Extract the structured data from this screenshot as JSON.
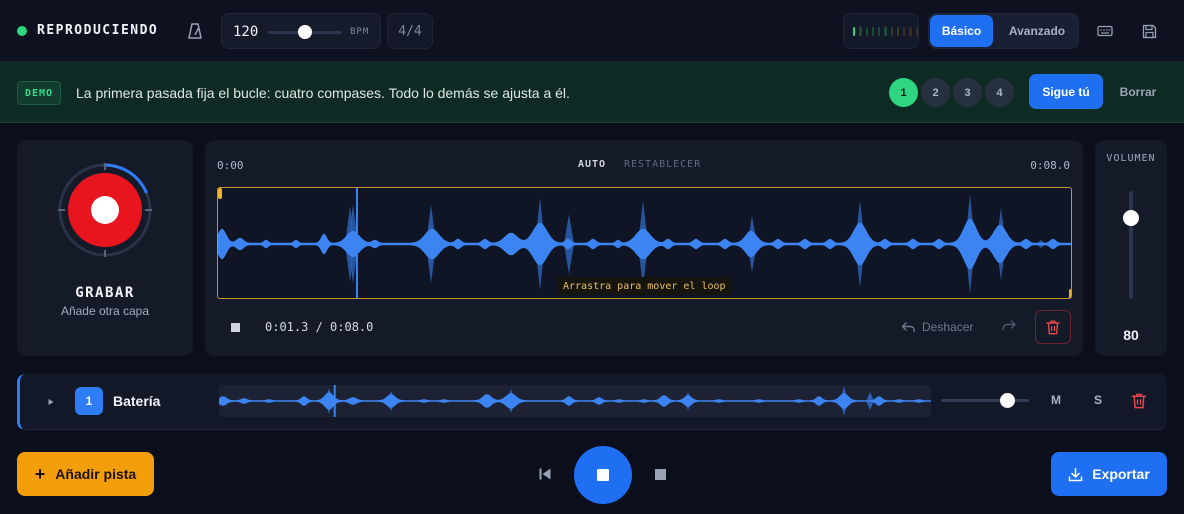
{
  "header": {
    "status": "REPRODUCIENDO",
    "bpm_value": "120",
    "bpm_unit": "BPM",
    "time_signature": "4/4",
    "mode_basic": "Básico",
    "mode_advanced": "Avanzado",
    "bpm_slider_fraction": 0.45
  },
  "banner": {
    "badge": "DEMO",
    "message": "La primera pasada fija el bucle: cuatro compases. Todo lo demás se ajusta a él.",
    "steps": [
      "1",
      "2",
      "3",
      "4"
    ],
    "active_step": "1",
    "follow_label": "Sigue tú",
    "clear_label": "Borrar"
  },
  "record": {
    "label": "GRABAR",
    "sublabel": "Añade otra capa"
  },
  "editor": {
    "time_start": "0:00",
    "time_end": "0:08.0",
    "auto_label": "AUTO",
    "reset_label": "RESTABLECER",
    "drag_hint": "Arrastra para mover el loop",
    "position": "0:01.3 / 0:08.0",
    "undo_label": "Deshacer",
    "playhead_fraction": 0.1625
  },
  "volume": {
    "label": "VOLUMEN",
    "value": "80"
  },
  "track": {
    "number": "1",
    "name": "Batería",
    "mute": "M",
    "solo": "S",
    "volume_fraction": 0.75
  },
  "footer": {
    "add_track": "Añadir pista",
    "export": "Exportar"
  },
  "colors": {
    "accent": "#1f6ff2",
    "record_red": "#e8141e",
    "status_green": "#2fd57f",
    "waveform": "#3c84f2",
    "loop_border": "#c9952a",
    "add_track_orange": "#f59e0b"
  },
  "icons": {
    "status": "status-dot",
    "metronome": "metronome-icon",
    "keyboard": "keyboard-icon",
    "save": "save-icon",
    "undo": "undo-icon",
    "redo": "redo-icon",
    "delete": "trash-icon",
    "play": "play-icon",
    "prev": "skip-back-icon",
    "stop": "stop-icon",
    "export": "download-icon",
    "add": "plus-icon"
  }
}
